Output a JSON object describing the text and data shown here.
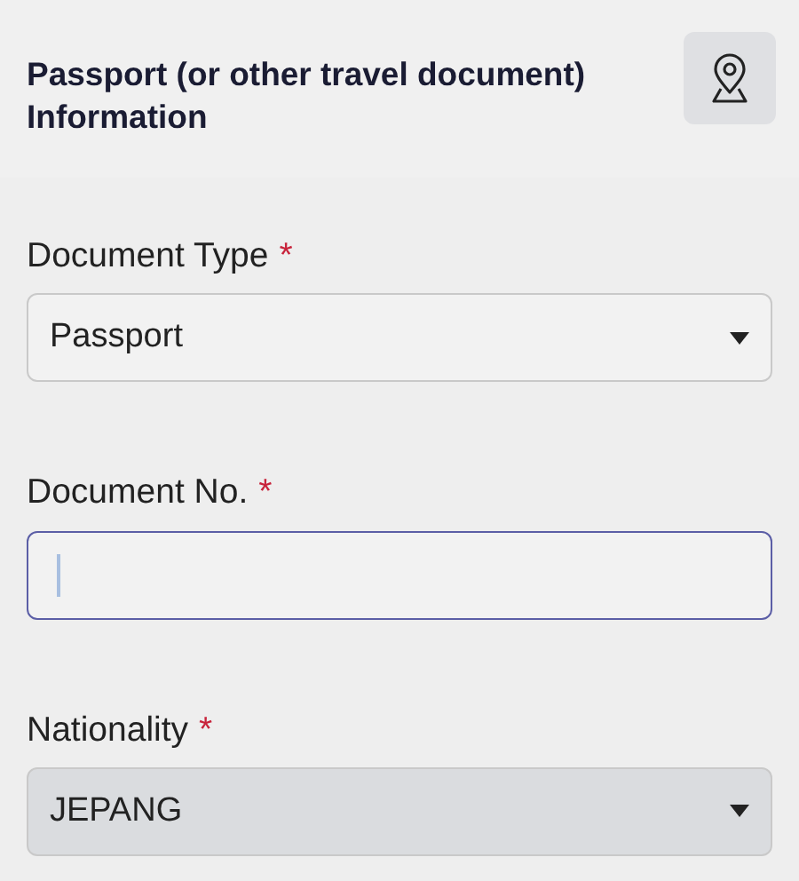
{
  "section": {
    "title": "Passport (or other travel document) Information"
  },
  "fields": [
    {
      "kind": "select",
      "label": "Document Type",
      "required_mark": "*",
      "value": "Passport",
      "focused": false,
      "disabled": false
    },
    {
      "kind": "text",
      "label": "Document No.",
      "required_mark": "*",
      "focused": true,
      "disabled": false
    },
    {
      "kind": "select",
      "label": "Nationality",
      "required_mark": "*",
      "value": "JEPANG",
      "focused": false,
      "disabled": true
    }
  ]
}
